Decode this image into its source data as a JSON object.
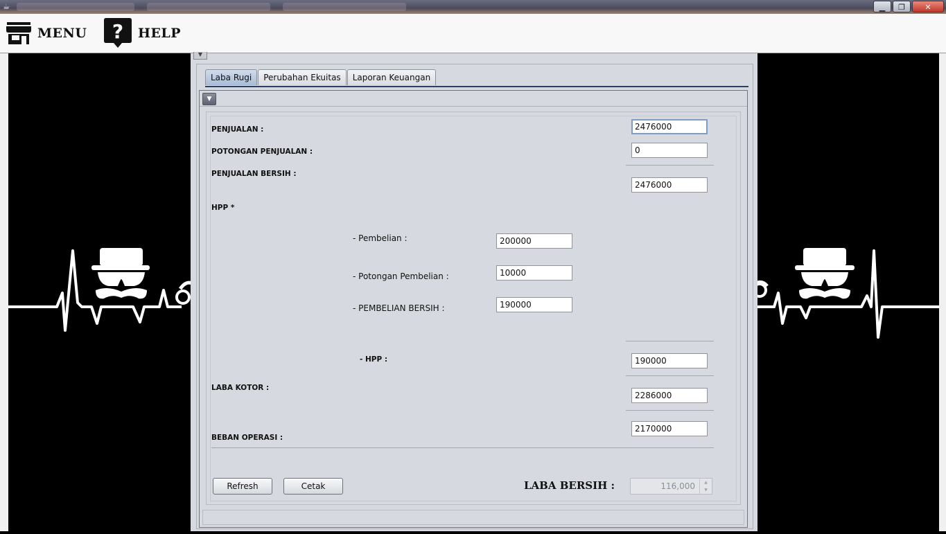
{
  "window": {
    "icon": "java-icon",
    "controls": {
      "minimize": "▁",
      "restore": "❐",
      "close": "✕"
    }
  },
  "menubar": {
    "menu_label": "MENU",
    "help_label": "HELP",
    "menu_icon": "store-icon",
    "help_icon": "question-icon"
  },
  "tabs": [
    {
      "label": "Laba Rugi",
      "active": true
    },
    {
      "label": "Perubahan Ekuitas",
      "active": false
    },
    {
      "label": "Laporan Keuangan",
      "active": false
    }
  ],
  "form": {
    "penjualan": {
      "label": "PENJUALAN :",
      "value": "2476000"
    },
    "potongan_penjualan": {
      "label": "POTONGAN PENJUALAN :",
      "value": "0"
    },
    "penjualan_bersih": {
      "label": "PENJUALAN BERSIH :",
      "value": "2476000"
    },
    "hpp_heading": "HPP *",
    "pembelian": {
      "label": "- Pembelian :",
      "value": "200000"
    },
    "potongan_pembelian": {
      "label": "- Potongan Pembelian :",
      "value": "10000"
    },
    "pembelian_bersih": {
      "label": "- PEMBELIAN BERSIH  :",
      "value": "190000"
    },
    "hpp": {
      "label": "- HPP :",
      "value": "190000"
    },
    "laba_kotor": {
      "label": "LABA KOTOR :",
      "value": "2286000"
    },
    "beban_operasi": {
      "label": "BEBAN OPERASI :",
      "value": "2170000"
    }
  },
  "actions": {
    "refresh_label": "Refresh",
    "cetak_label": "Cetak"
  },
  "laba_bersih": {
    "label": "LABA BERSIH :",
    "value": "116,000"
  },
  "colors": {
    "tab_active": "#a9bcd6",
    "tab_underline": "#2a3f66",
    "panel_bg": "#d6d9df",
    "close_button": "#c2382a"
  }
}
